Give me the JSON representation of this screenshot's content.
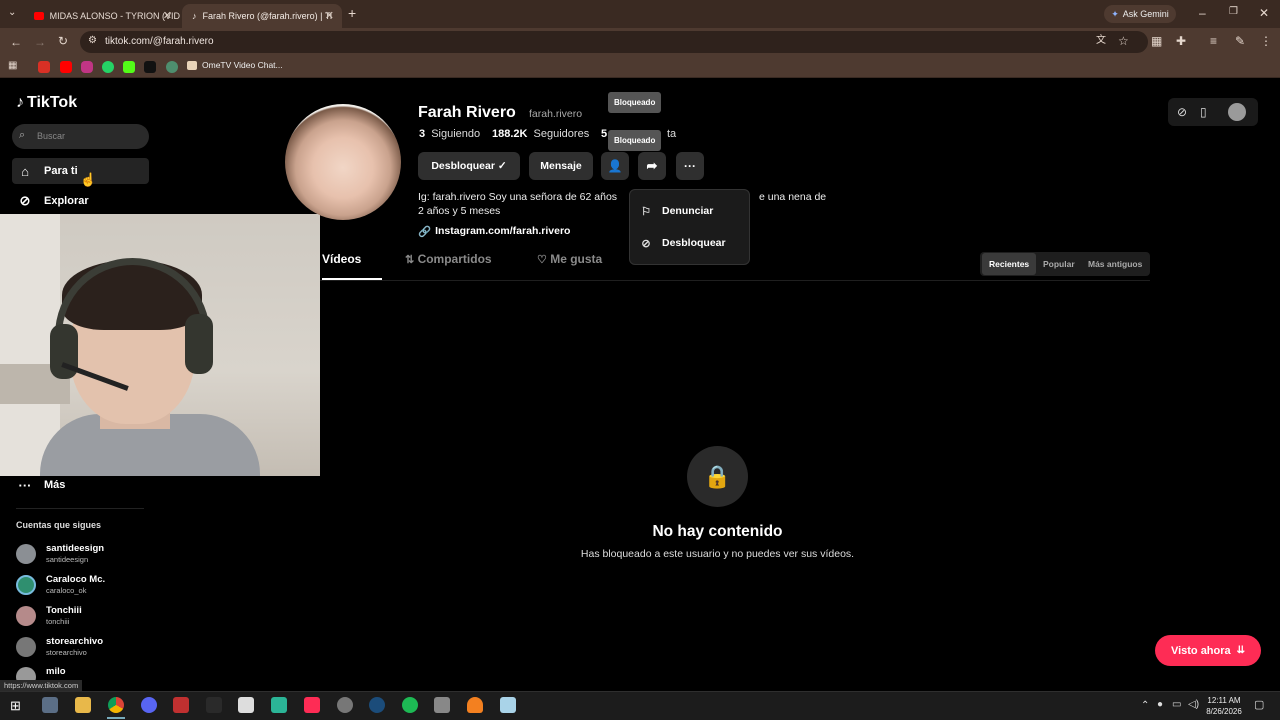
{
  "browser": {
    "tabs": [
      {
        "title": "MIDAS ALONSO - TYRION (VID",
        "active": false
      },
      {
        "title": "Farah Rivero (@farah.rivero) | Ti",
        "active": true
      }
    ],
    "new_tab": "+",
    "ask_gemini": "Ask Gemini",
    "url": "tiktok.com/@farah.rivero",
    "bookmark_label": "OmeTV Video Chat..."
  },
  "sidebar": {
    "logo": "TikTok",
    "search_placeholder": "Buscar",
    "items": [
      {
        "label": "Para ti"
      },
      {
        "label": "Explorar"
      },
      {
        "label": "Más"
      }
    ],
    "following_title": "Cuentas que sigues",
    "following": [
      {
        "name": "santideesign",
        "handle": "santideesign"
      },
      {
        "name": "Caraloco Mc.",
        "handle": "caraloco_ok"
      },
      {
        "name": "Tonchiii",
        "handle": "tonchiii"
      },
      {
        "name": "storearchivo",
        "handle": "storearchivo"
      },
      {
        "name": "milo",
        "handle": ""
      }
    ]
  },
  "profile": {
    "name": "Farah Rivero",
    "handle": "farah.rivero",
    "following_count": "3",
    "following_label": "Siguiendo",
    "followers_count": "188.2K",
    "followers_label": "Seguidores",
    "likes_partial": "5",
    "likes_partial_tail": "ta",
    "unblock_button": "Desbloquear ✓",
    "message_button": "Mensaje",
    "bio_line1_a": "Ig: farah.rivero Soy una señora de 62 años",
    "bio_line1_b": "e una nena de",
    "bio_line2": "2 años y 5 meses",
    "link": "Instagram.com/farah.rivero",
    "tooltip_1": "Bloqueado",
    "tooltip_2": "Bloqueado"
  },
  "dropdown": {
    "items": [
      {
        "label": "Denunciar",
        "icon": "flag-icon"
      },
      {
        "label": "Desbloquear",
        "icon": "block-icon"
      }
    ]
  },
  "content_tabs": [
    {
      "label": "Vídeos",
      "active": true
    },
    {
      "label": "Compartidos",
      "icon": "repost-icon"
    },
    {
      "label": "Me gusta",
      "icon": "heart-icon"
    }
  ],
  "sort": {
    "options": [
      "Recientes",
      "Popular",
      "Más antiguos"
    ],
    "selected": "Recientes"
  },
  "empty_state": {
    "title": "No hay contenido",
    "subtitle": "Has bloqueado a este usuario y no puedes ver sus vídeos."
  },
  "visto_ahora": "Visto ahora",
  "status_url": "https://www.tiktok.com",
  "system_tray": {
    "time": "12:11 AM",
    "date": "8/26/2026"
  },
  "colors": {
    "accent": "#fe2c55",
    "chrome_bg": "#3a2a22",
    "toolbar_bg": "#4e3a30"
  }
}
